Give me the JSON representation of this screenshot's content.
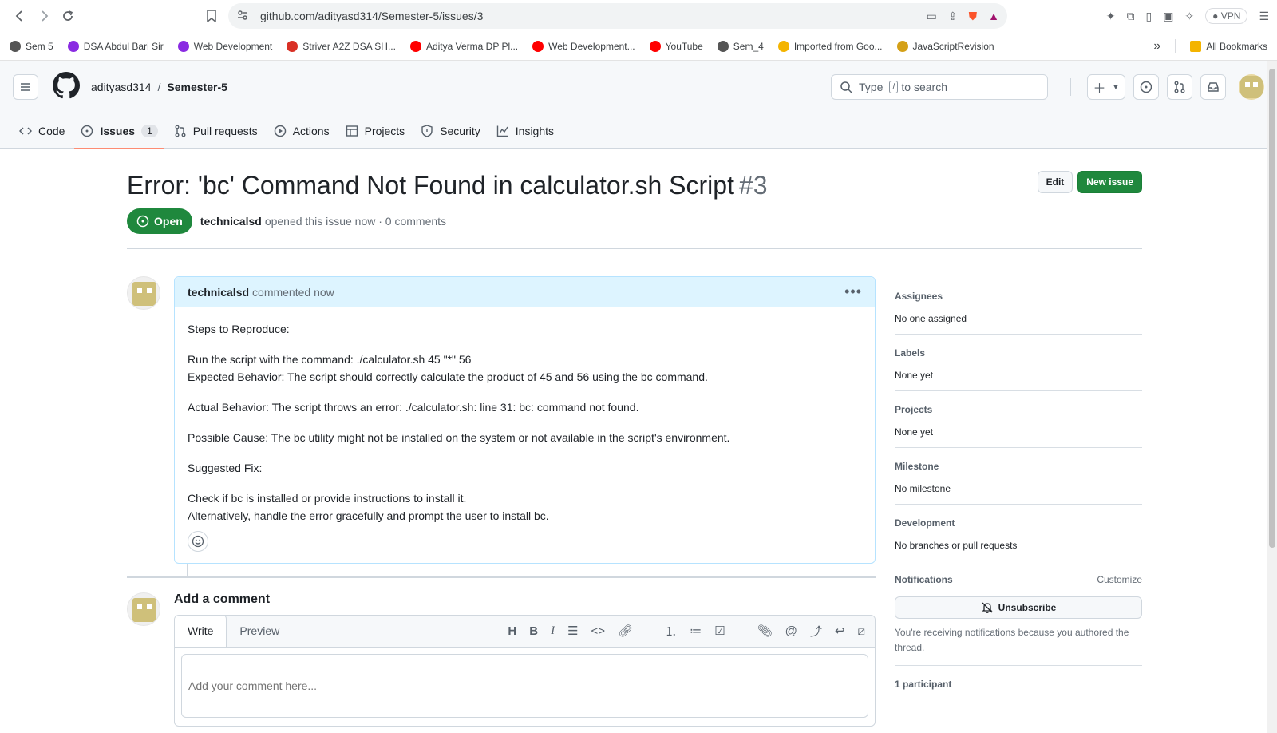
{
  "browser": {
    "url": "github.com/adityasd314/Semester-5/issues/3",
    "vpn_label": "VPN",
    "bookmarks": [
      {
        "label": "Sem 5",
        "color": "#555555"
      },
      {
        "label": "DSA Abdul Bari Sir",
        "color": "#8a2be2"
      },
      {
        "label": "Web Development",
        "color": "#8a2be2"
      },
      {
        "label": "Striver A2Z DSA SH...",
        "color": "#d93025"
      },
      {
        "label": "Aditya Verma DP Pl...",
        "color": "#ff0000"
      },
      {
        "label": "Web Development...",
        "color": "#ff0000"
      },
      {
        "label": "YouTube",
        "color": "#ff0000"
      },
      {
        "label": "Sem_4",
        "color": "#555555"
      },
      {
        "label": "Imported from Goo...",
        "color": "#f4b400"
      },
      {
        "label": "JavaScriptRevision",
        "color": "#d4a017"
      }
    ],
    "more_label": "»",
    "all_bookmarks": "All Bookmarks"
  },
  "header": {
    "owner": "adityasd314",
    "separator": "/",
    "repo": "Semester-5",
    "search_type": "Type",
    "search_key": "/",
    "search_rest": "to search"
  },
  "tabs": [
    {
      "label": "Code"
    },
    {
      "label": "Issues",
      "count": "1"
    },
    {
      "label": "Pull requests"
    },
    {
      "label": "Actions"
    },
    {
      "label": "Projects"
    },
    {
      "label": "Security"
    },
    {
      "label": "Insights"
    }
  ],
  "issue": {
    "title": "Error: 'bc' Command Not Found in calculator.sh Script",
    "number": "#3",
    "edit_label": "Edit",
    "new_issue_label": "New issue",
    "state": "Open",
    "author": "technicalsd",
    "meta_text": "opened this issue now · 0 comments"
  },
  "comment": {
    "author": "technicalsd",
    "time": "commented now",
    "lines": [
      "Steps to Reproduce:",
      "Run the script with the command: ./calculator.sh 45 \"*\" 56",
      "Expected Behavior: The script should correctly calculate the product of 45 and 56 using the bc command.",
      "Actual Behavior: The script throws an error: ./calculator.sh: line 31: bc: command not found.",
      "Possible Cause: The bc utility might not be installed on the system or not available in the script's environment.",
      "Suggested Fix:",
      "Check if bc is installed or provide instructions to install it.",
      "Alternatively, handle the error gracefully and prompt the user to install bc."
    ]
  },
  "add_comment": {
    "heading": "Add a comment",
    "write_tab": "Write",
    "preview_tab": "Preview",
    "placeholder": "Add your comment here..."
  },
  "sidebar": {
    "assignees_title": "Assignees",
    "assignees_value": "No one assigned",
    "labels_title": "Labels",
    "labels_value": "None yet",
    "projects_title": "Projects",
    "projects_value": "None yet",
    "milestone_title": "Milestone",
    "milestone_value": "No milestone",
    "development_title": "Development",
    "development_value": "No branches or pull requests",
    "notifications_title": "Notifications",
    "customize_label": "Customize",
    "unsubscribe_label": "Unsubscribe",
    "notifications_note": "You're receiving notifications because you authored the thread.",
    "participants": "1 participant"
  },
  "colors": {
    "open_green": "#1f883d",
    "active_tab_underline": "#fd8c73",
    "comment_header_bg": "#ddf4ff"
  }
}
